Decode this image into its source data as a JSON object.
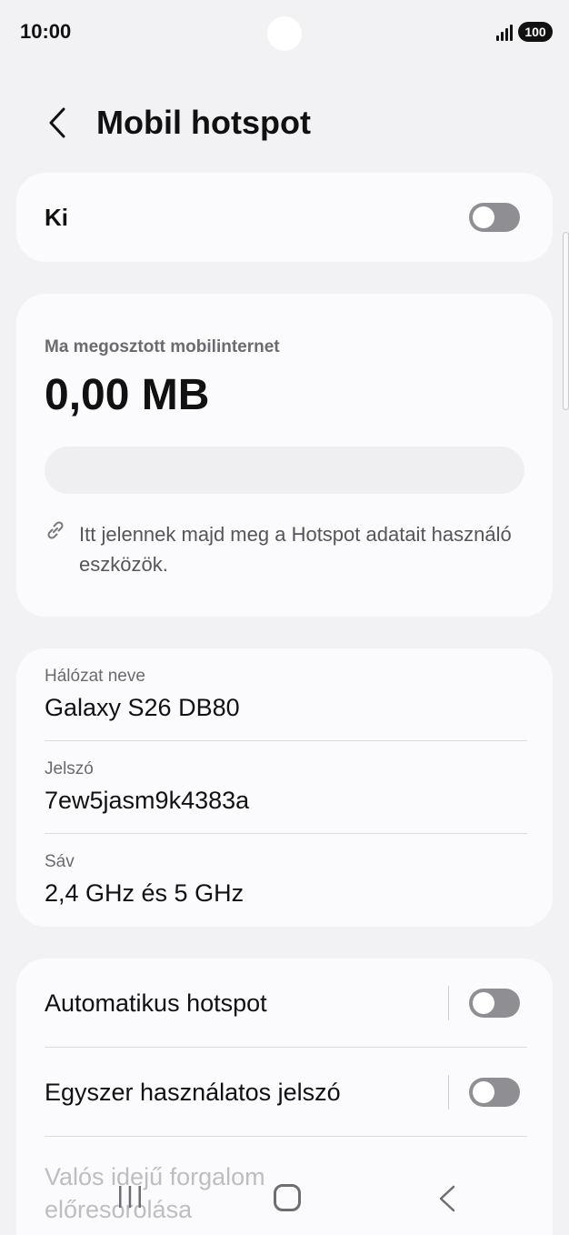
{
  "status_bar": {
    "time": "10:00",
    "battery": "100"
  },
  "header": {
    "title": "Mobil hotspot"
  },
  "main_toggle": {
    "label": "Ki",
    "on": false
  },
  "usage": {
    "label": "Ma megosztott mobilinternet",
    "value": "0,00 MB",
    "progress": 0,
    "devices_text": "Itt jelennek majd meg a Hotspot adatait használó eszközök."
  },
  "network": {
    "fields": [
      {
        "caption": "Hálózat neve",
        "value": "Galaxy S26 DB80"
      },
      {
        "caption": "Jelszó",
        "value": "7ew5jasm9k4383a"
      },
      {
        "caption": "Sáv",
        "value": "2,4 GHz és 5 GHz"
      }
    ]
  },
  "options": {
    "auto_hotspot": {
      "label": "Automatikus hotspot",
      "on": false
    },
    "one_time_password": {
      "label": "Egyszer használatos jelszó",
      "on": false
    },
    "realtime_priority": {
      "label": "Valós idejű forgalom előresorolása"
    }
  },
  "colors": {
    "background": "#f2f2f4",
    "card": "#fbfbfd",
    "toggle_off": "#8e8e93"
  }
}
